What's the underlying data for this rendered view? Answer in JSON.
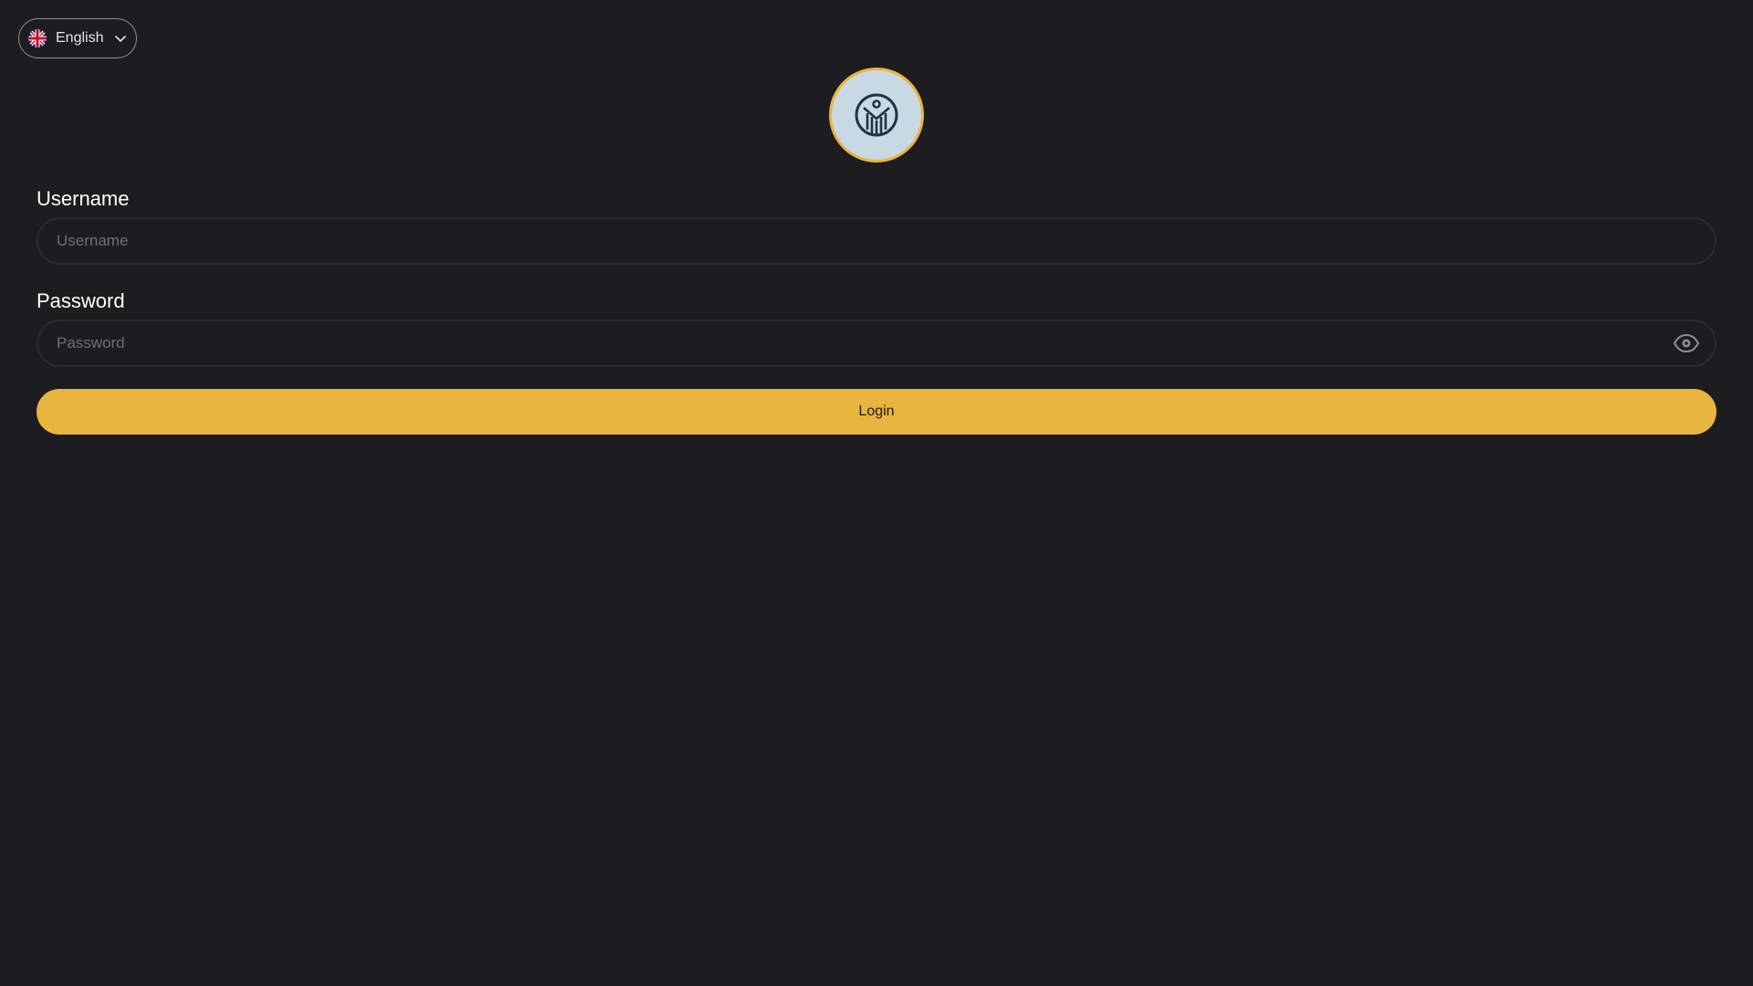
{
  "language_selector": {
    "selected": "English",
    "flag_icon": "uk-flag-icon",
    "dropdown_icon": "chevron-down-icon"
  },
  "logo": {
    "icon": "brand-logo-icon",
    "ring_color": "#e8b53f",
    "fill_color": "#c9d9e3"
  },
  "form": {
    "username": {
      "label": "Username",
      "placeholder": "Username",
      "value": ""
    },
    "password": {
      "label": "Password",
      "placeholder": "Password",
      "value": "",
      "toggle_icon": "eye-icon"
    },
    "submit_label": "Login"
  },
  "colors": {
    "background": "#1d1c21",
    "accent": "#e8b53f",
    "field_border": "#2c2b31"
  }
}
